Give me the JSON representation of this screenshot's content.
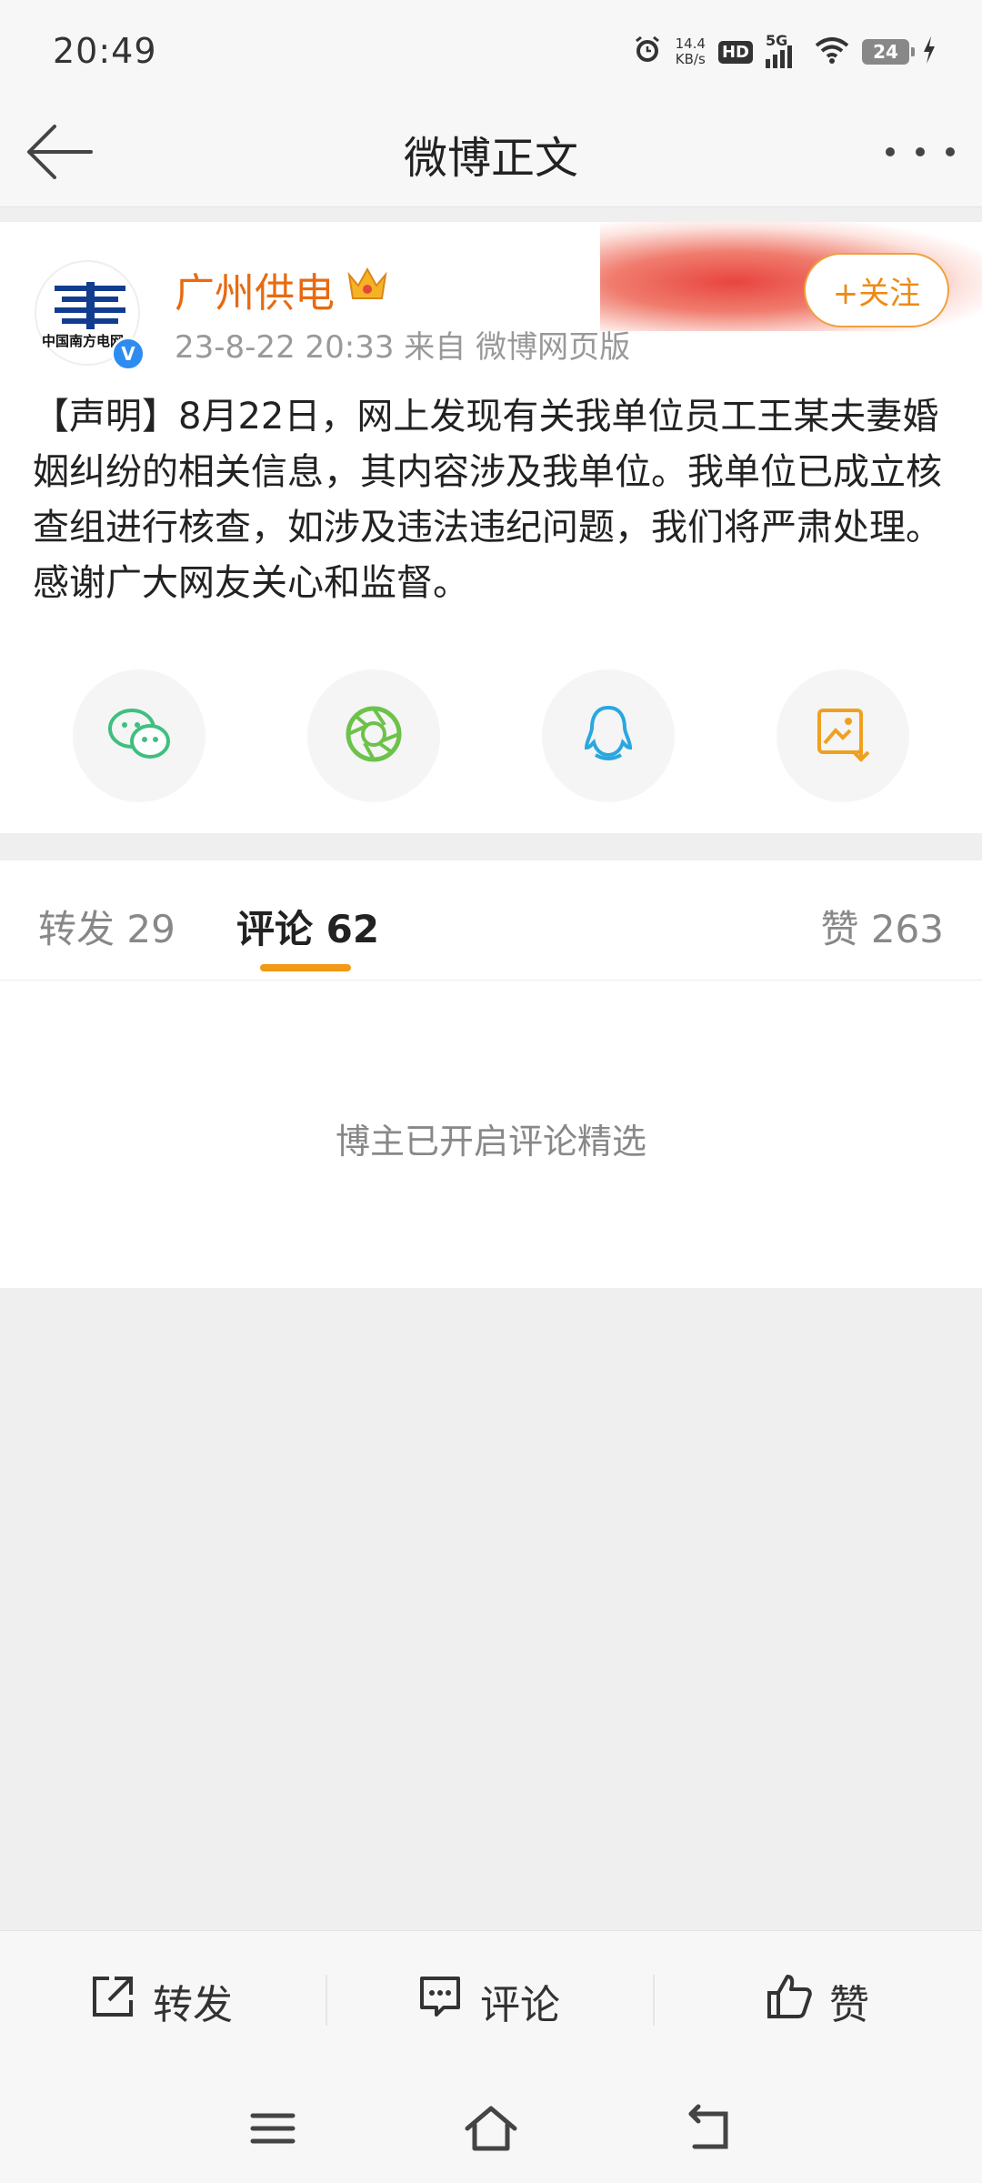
{
  "status_bar": {
    "time": "20:49",
    "net_speed_value": "14.4",
    "net_speed_unit": "KB/s",
    "hd_label": "HD",
    "network": "5G",
    "battery": "24",
    "icons": [
      "alarm-icon",
      "hd-icon",
      "signal-icon",
      "wifi-icon",
      "battery-icon",
      "charging-icon"
    ]
  },
  "nav": {
    "title": "微博正文",
    "back_icon": "back-arrow-icon",
    "more_icon": "more-icon"
  },
  "post": {
    "username": "广州供电",
    "avatar_text": "中国南方电网",
    "verified_label": "V",
    "meta": "23-8-22 20:33  来自 微博网页版",
    "follow_label": "+关注",
    "text": "【声明】8月22日，网上发现有关我单位员工王某夫妻婚姻纠纷的相关信息，其内容涉及我单位。我单位已成立核查组进行核查，如涉及违法违纪问题，我们将严肃处理。感谢广大网友关心和监督。",
    "accent_color": "#e86a10",
    "share": [
      "wechat-icon",
      "moments-icon",
      "qq-icon",
      "save-image-icon"
    ]
  },
  "tabs": {
    "repost": "转发 29",
    "comments": "评论 62",
    "likes": "赞 263",
    "active": "comments",
    "underline_color": "#f09a16"
  },
  "comments": {
    "note": "博主已开启评论精选"
  },
  "toolbar": {
    "repost_label": "转发",
    "comment_label": "评论",
    "like_label": "赞"
  },
  "system_nav": [
    "menu-icon",
    "home-icon",
    "back-icon"
  ]
}
